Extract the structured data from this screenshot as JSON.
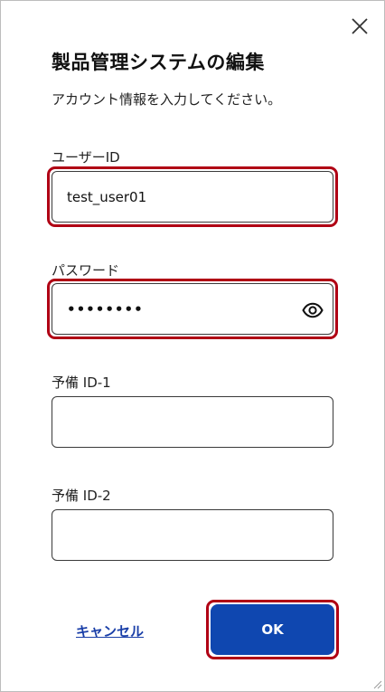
{
  "dialog": {
    "title": "製品管理システムの編集",
    "subtitle": "アカウント情報を入力してください。"
  },
  "fields": {
    "user_id": {
      "label": "ユーザーID",
      "value": "test_user01"
    },
    "password": {
      "label": "パスワード",
      "masked_value": "••••••••"
    },
    "spare_id_1": {
      "label": "予備 ID-1",
      "value": ""
    },
    "spare_id_2": {
      "label": "予備 ID-2",
      "value": ""
    }
  },
  "actions": {
    "cancel_label": "キャンセル",
    "ok_label": "OK"
  },
  "icons": {
    "close": "close-icon",
    "password_toggle": "eye-icon",
    "resize": "resize-grip-icon"
  },
  "colors": {
    "primary": "#0f47b0",
    "highlight": "#b00014",
    "link": "#1a3fa8"
  }
}
